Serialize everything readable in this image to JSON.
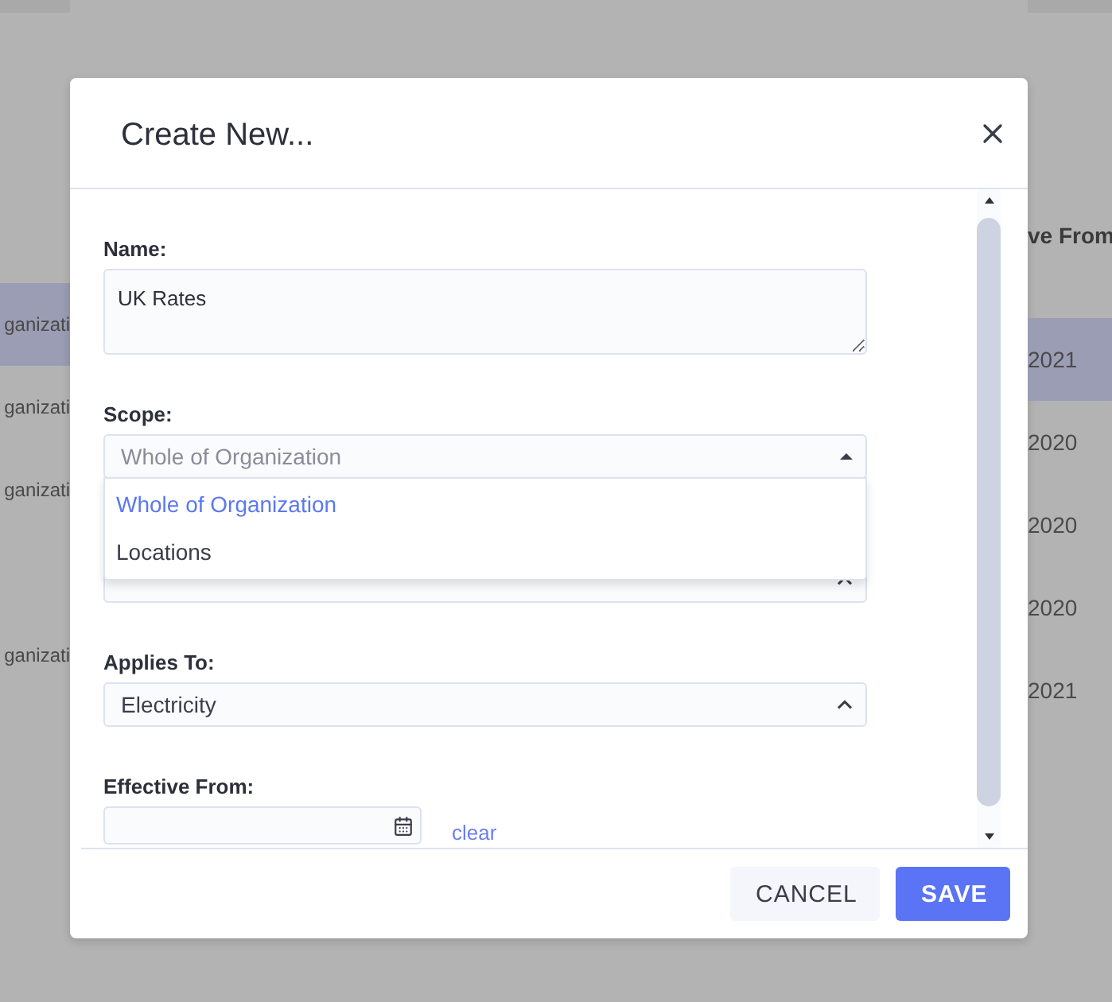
{
  "background_table": {
    "header": "ve From",
    "rows": [
      {
        "column_1": "ganizati",
        "column_2": "2021",
        "selected": true
      },
      {
        "column_1": "ganizati",
        "column_2": "2020",
        "selected": false
      },
      {
        "column_1": "ganizati",
        "column_2": "2020",
        "selected": false
      },
      {
        "column_2": "2020",
        "selected": false
      },
      {
        "column_1": "ganizati",
        "column_2": "2021",
        "selected": false
      }
    ]
  },
  "dialog": {
    "title": "Create New...",
    "fields": [
      {
        "kind": "textarea",
        "label": "Name:",
        "value": "UK Rates"
      },
      {
        "kind": "select",
        "label": "Scope:",
        "value": "Whole of Organization",
        "expanded": true,
        "options": [
          {
            "label": "Whole of Organization",
            "selected": true
          },
          {
            "label": "Locations",
            "selected": false
          }
        ]
      },
      {
        "kind": "select",
        "expanded": false
      },
      {
        "kind": "select",
        "label": "Applies To:",
        "value": "Electricity",
        "expanded": false
      },
      {
        "kind": "date",
        "label": "Effective From:",
        "link": "clear"
      }
    ],
    "buttons": [
      {
        "label": "CANCEL",
        "kind": "secondary"
      },
      {
        "label": "SAVE",
        "kind": "primary"
      }
    ]
  }
}
